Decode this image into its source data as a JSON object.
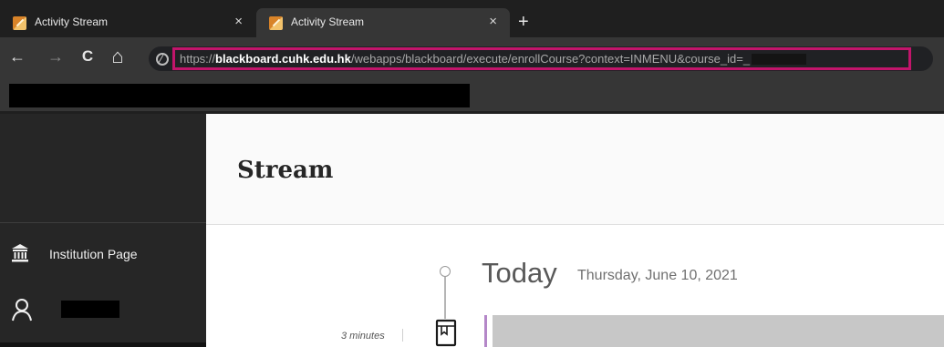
{
  "browser": {
    "tabs": [
      {
        "title": "Activity Stream",
        "active": false,
        "close": "×"
      },
      {
        "title": "Activity Stream",
        "active": true,
        "close": "×"
      }
    ],
    "new_tab": "+",
    "nav": {
      "back": "←",
      "forward": "→",
      "reload": "C",
      "home": "⌂"
    },
    "url": {
      "scheme": "https://",
      "host": "blackboard.cuhk.edu.hk",
      "path": "/webapps/blackboard/execute/enrollCourse?context=INMENU&course_id=_"
    },
    "highlight_color": "#c2156b"
  },
  "sidebar": {
    "items": [
      {
        "label": "Institution Page",
        "icon": "institution-icon"
      },
      {
        "icon": "user-icon"
      }
    ]
  },
  "main": {
    "title": "Stream",
    "timeline": {
      "heading": "Today",
      "date": "Thursday, June 10, 2021",
      "entries": [
        {
          "time": "3 minutes",
          "icon": "book-icon",
          "accent_color": "#b487c8"
        }
      ]
    }
  }
}
